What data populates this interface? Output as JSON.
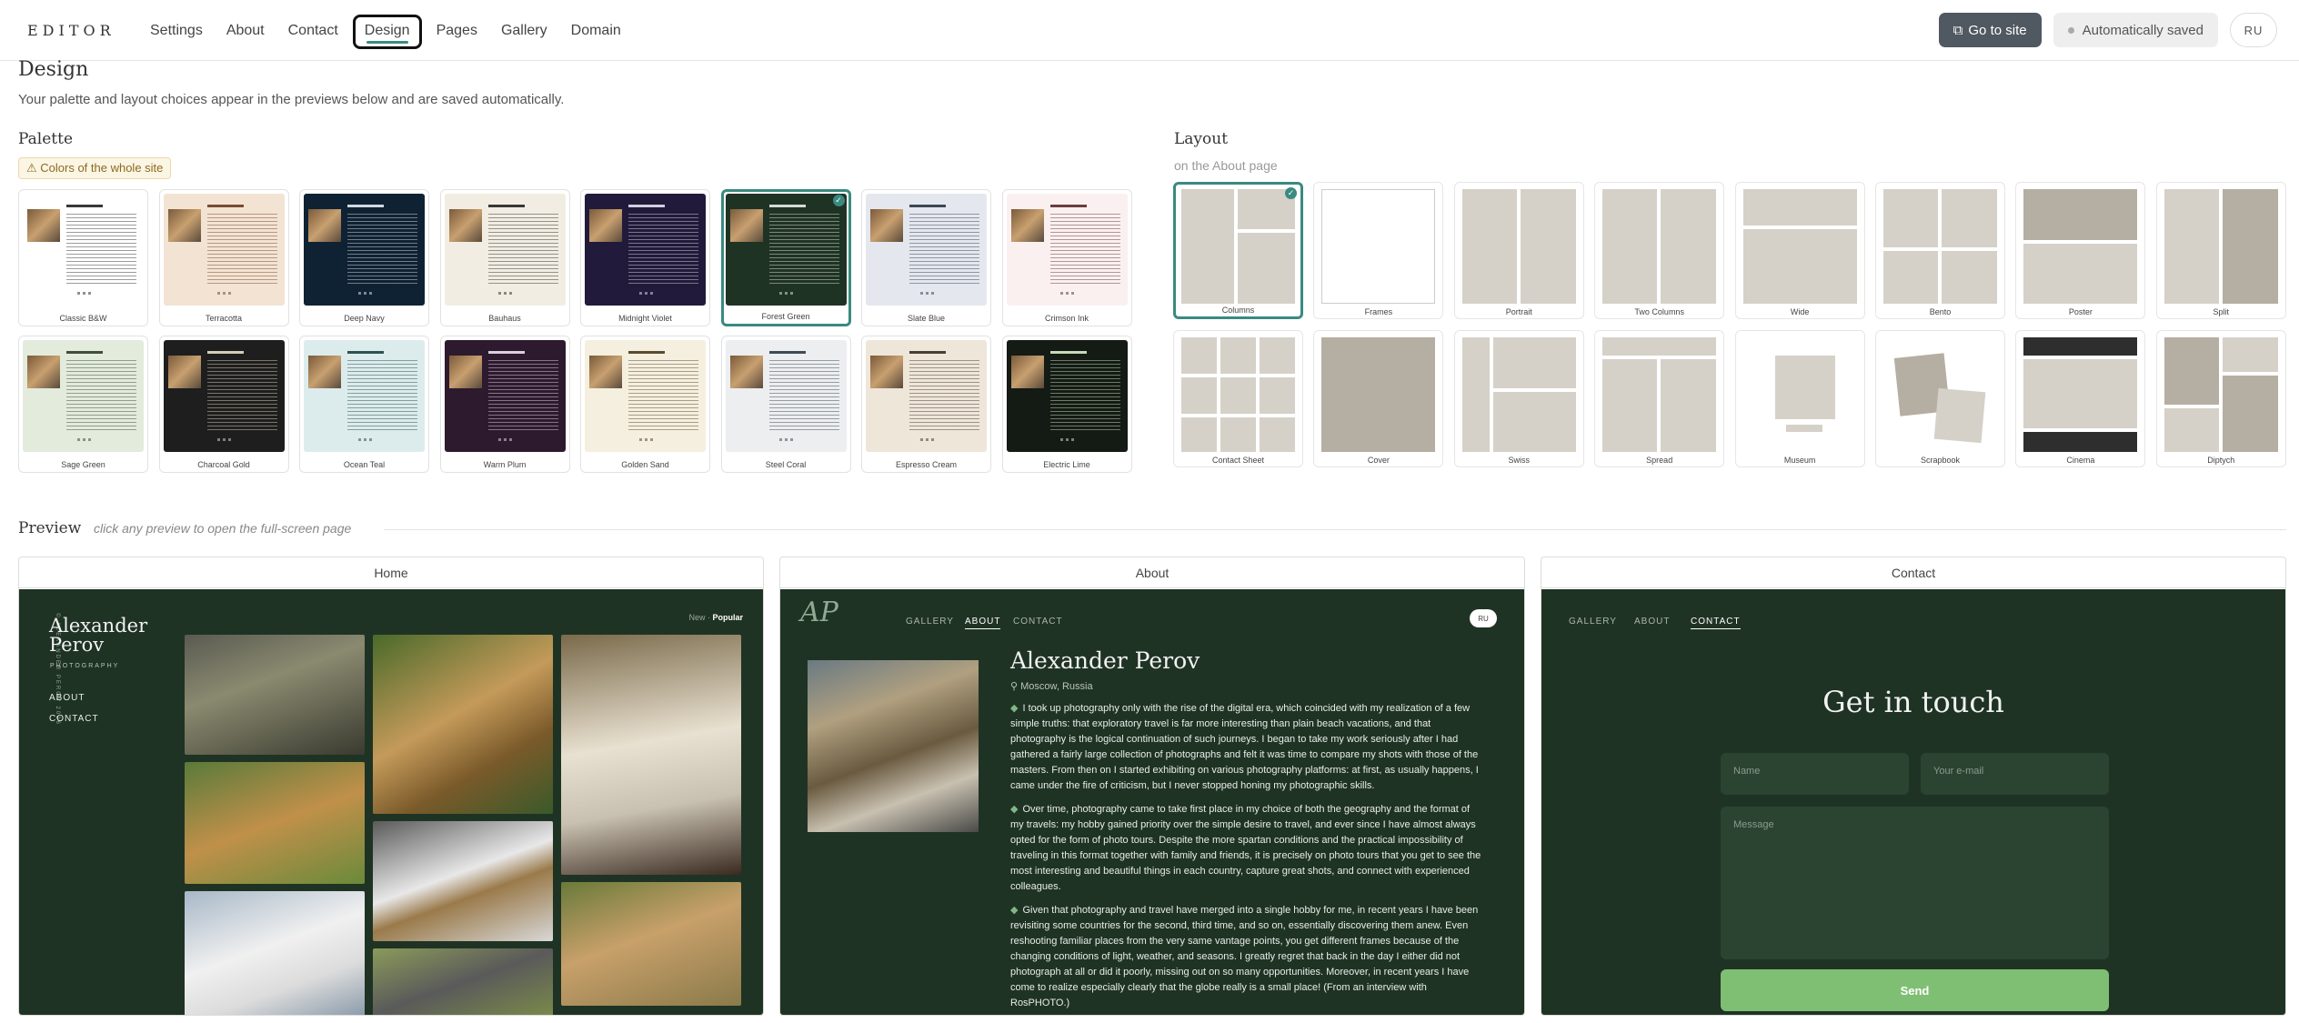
{
  "topbar": {
    "logo": "EDITOR",
    "nav": [
      "Settings",
      "About",
      "Contact",
      "Design",
      "Pages",
      "Gallery",
      "Domain"
    ],
    "active_nav": "Design",
    "go_to_site": "Go to site",
    "autosave": "Automatically saved",
    "lang": "RU"
  },
  "design": {
    "title": "Design",
    "subtitle": "Your palette and layout choices appear in the previews below and are saved automatically."
  },
  "palette": {
    "title": "Palette",
    "warning": "⚠ Colors of the whole site",
    "selected": "Forest Green",
    "items": [
      {
        "name": "Classic B&W",
        "bg": "#ffffff",
        "fg": "#222222"
      },
      {
        "name": "Terracotta",
        "bg": "#f3e3d3",
        "fg": "#6b3b22"
      },
      {
        "name": "Deep Navy",
        "bg": "#0f2233",
        "fg": "#e6edf3"
      },
      {
        "name": "Bauhaus",
        "bg": "#f1ede2",
        "fg": "#222222"
      },
      {
        "name": "Midnight Violet",
        "bg": "#211a3a",
        "fg": "#e6e1f3"
      },
      {
        "name": "Forest Green",
        "bg": "#1f3324",
        "fg": "#e8ede9"
      },
      {
        "name": "Slate Blue",
        "bg": "#e4e8ee",
        "fg": "#2a3444"
      },
      {
        "name": "Crimson Ink",
        "bg": "#fbf0f0",
        "fg": "#5a2a2a"
      },
      {
        "name": "Sage Green",
        "bg": "#e3ebdd",
        "fg": "#2f3d2a"
      },
      {
        "name": "Charcoal Gold",
        "bg": "#1e1e1e",
        "fg": "#e8e0c8"
      },
      {
        "name": "Ocean Teal",
        "bg": "#dcecec",
        "fg": "#1e4040"
      },
      {
        "name": "Warm Plum",
        "bg": "#2e1a2e",
        "fg": "#efe2ef"
      },
      {
        "name": "Golden Sand",
        "bg": "#f5efdf",
        "fg": "#4a3a1e"
      },
      {
        "name": "Steel Coral",
        "bg": "#eceef0",
        "fg": "#2e3a44"
      },
      {
        "name": "Espresso Cream",
        "bg": "#efe6da",
        "fg": "#3a2a1e"
      },
      {
        "name": "Electric Lime",
        "bg": "#141a14",
        "fg": "#d8f0c8"
      }
    ]
  },
  "layout": {
    "title": "Layout",
    "subtitle": "on the About page",
    "selected": "Columns",
    "items": [
      "Columns",
      "Frames",
      "Portrait",
      "Two Columns",
      "Wide",
      "Bento",
      "Poster",
      "Split",
      "Contact Sheet",
      "Cover",
      "Swiss",
      "Spread",
      "Museum",
      "Scrapbook",
      "Cinema",
      "Diptych"
    ]
  },
  "preview": {
    "title": "Preview",
    "hint": "click any preview to open the full-screen page",
    "columns": [
      "Home",
      "About",
      "Contact"
    ],
    "home": {
      "name_line1": "Alexander",
      "name_line2": "Perov",
      "tagline": "PHOTOGRAPHY",
      "vertical": "© ALEXANDER PEROV 2026",
      "nav": [
        "ABOUT",
        "CONTACT"
      ],
      "sort_new": "New ·",
      "sort_popular": "Popular"
    },
    "about": {
      "logo": "AP",
      "nav": [
        "GALLERY",
        "ABOUT",
        "CONTACT"
      ],
      "lang": "RU",
      "name": "Alexander Perov",
      "location": "Moscow, Russia",
      "paragraphs": [
        "I took up photography only with the rise of the digital era, which coincided with my realization of a few simple truths: that exploratory travel is far more interesting than plain beach vacations, and that photography is the logical continuation of such journeys. I began to take my work seriously after I had gathered a fairly large collection of photographs and felt it was time to compare my shots with those of the masters. From then on I started exhibiting on various photography platforms: at first, as usually happens, I came under the fire of criticism, but I never stopped honing my photographic skills.",
        "Over time, photography came to take first place in my choice of both the geography and the format of my travels: my hobby gained priority over the simple desire to travel, and ever since I have almost always opted for the form of photo tours. Despite the more spartan conditions and the practical impossibility of traveling in this format together with family and friends, it is precisely on photo tours that you get to see the most interesting and beautiful things in each country, capture great shots, and connect with experienced colleagues.",
        "Given that photography and travel have merged into a single hobby for me, in recent years I have been revisiting some countries for the second, third time, and so on, essentially discovering them anew. Even reshooting familiar places from the very same vantage points, you get different frames because of the changing conditions of light, weather, and seasons. I greatly regret that back in the day I either did not photograph at all or did it poorly, missing out on so many opportunities. Moreover, in recent years I have come to realize especially clearly that the globe really is a small place! (From an interview with RosPHOTO.)"
      ]
    },
    "contact": {
      "nav": [
        "GALLERY",
        "ABOUT",
        "CONTACT"
      ],
      "title": "Get in touch",
      "name_placeholder": "Name",
      "email_placeholder": "Your e-mail",
      "message_placeholder": "Message",
      "send": "Send"
    }
  }
}
